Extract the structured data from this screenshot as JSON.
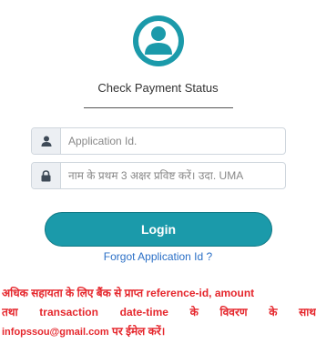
{
  "header": {
    "avatar_icon": "user-avatar-icon",
    "title": "Check Payment Status"
  },
  "form": {
    "application_id": {
      "icon": "user-icon",
      "value": "",
      "placeholder": "Application Id."
    },
    "name_field": {
      "icon": "lock-icon",
      "value": "",
      "placeholder": "नाम के प्रथम 3 अक्षर प्रविष्ट करें। उदा. UMA"
    },
    "login_label": "Login",
    "forgot_label": "Forgot Application Id ?"
  },
  "notice": {
    "line1": "अधिक सहायता के लिए बैंक से प्राप्त reference-id, amount",
    "line2": "तथा transaction date-time के विवरण के साथ",
    "email": "infopssou@gmail.com",
    "line3_suffix": " पर ईमेल करें।"
  },
  "colors": {
    "accent": "#1b9aaa",
    "link": "#2a6fc6",
    "notice": "#e5262c"
  }
}
